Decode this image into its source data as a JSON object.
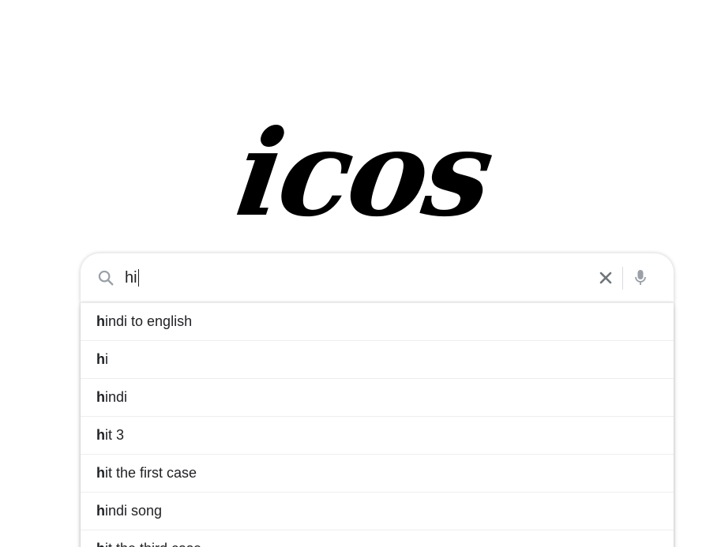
{
  "logo": {
    "text": "icos"
  },
  "search": {
    "query": "hi",
    "query_bold_prefix": "h"
  },
  "suggestions": [
    {
      "bold": "h",
      "rest": "indi to english"
    },
    {
      "bold": "h",
      "rest": "i"
    },
    {
      "bold": "h",
      "rest": "indi"
    },
    {
      "bold": "h",
      "rest": "it 3"
    },
    {
      "bold": "h",
      "rest": "it the first case"
    },
    {
      "bold": "h",
      "rest": "indi song"
    },
    {
      "bold": "h",
      "rest": "it the third case"
    }
  ],
  "icons": {
    "search": "search-icon",
    "clear": "close-icon",
    "mic": "microphone-icon"
  },
  "colors": {
    "icon_gray": "#9aa0a6",
    "clear_gray": "#70757a",
    "text": "#202124"
  }
}
